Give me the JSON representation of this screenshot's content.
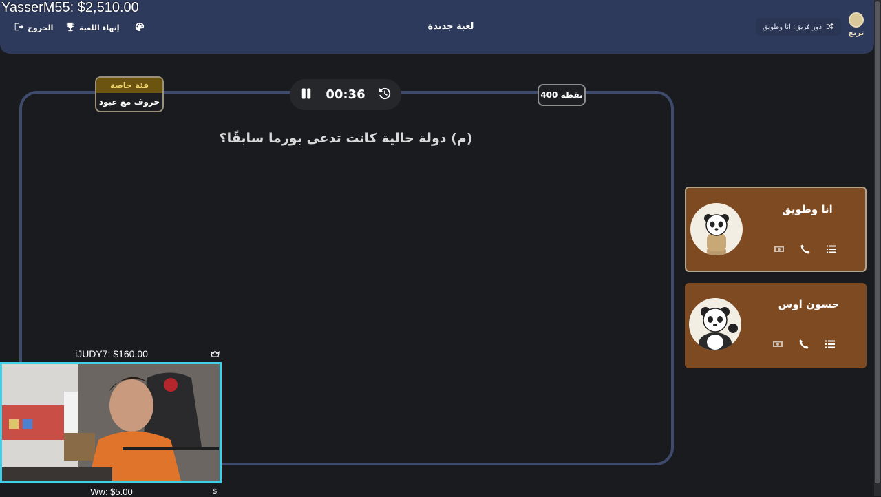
{
  "overlay": {
    "top_donation": "YasserM55: $2,510.00",
    "cam_top_label": "iJUDY7: $160.00",
    "cam_bottom_label": "Ww: $5.00",
    "cam_bottom_badge": "$"
  },
  "header": {
    "exit_label": "الخروج",
    "end_game_label": "إنهاء اللعبة",
    "new_game_label": "لعبة جديدة",
    "turn_label": "دور فريق: انا وطويق",
    "logo_text": "تربع"
  },
  "board": {
    "category_top": "فئة خاصة",
    "category_name": "حروف مع عبود",
    "timer": "00:36",
    "points": "400 نقطة",
    "question": "(م) دولة حالية كانت تدعى بورما سابقًا؟"
  },
  "teams": [
    {
      "name": "انا وطويق",
      "active": true
    },
    {
      "name": "حسون اوس",
      "active": false
    }
  ],
  "colors": {
    "header_bg": "#2e3a5c",
    "team_card": "#7e4a22",
    "board_border": "#3e4b6c",
    "cam_border": "#3fd0e6"
  }
}
